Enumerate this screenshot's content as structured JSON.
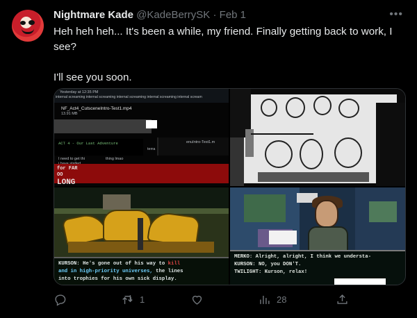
{
  "tweet": {
    "display_name": "Nightmare Kade",
    "handle": "@KadeBerrySK",
    "separator": "·",
    "date": "Feb 1",
    "more_icon": "•••",
    "text_line1": "Heh heh heh... It's been a while, my friend. Finally getting back to work, I see?",
    "text_line2": "I'll see you soon."
  },
  "media": {
    "tile1": {
      "header_small": "Yesterday at 12:35 PM",
      "scream_line": "internal screaming internal screaming internal screaming   internal screaming internal scream",
      "file_name": "NF_Act4_CutsceneIntro-Test1.mp4",
      "file_size": "13.91 MB",
      "act_line": "ACT 4 - Our Last Adventure",
      "fragment_1": "terra",
      "fragment_2": "enuIntro-Test1.m",
      "need_line": "I need to get thi",
      "thing_line": "thing lmao",
      "stalled_line": "i have stalled",
      "far_text": "for FAR",
      "too_text": "OO",
      "long_text": "LONG"
    },
    "tile3": {
      "line1_a": "KURSON: He's gone out of his way to ",
      "line1_b": "kill",
      "line2_a": "and in high-priority universes, ",
      "line2_b": "the lines",
      "line3": "into trophies for his own sick display."
    },
    "tile4": {
      "line1": "MERKO: Alright, alright, I think we understa-",
      "line2": "KURSON: NO, you DON'T.",
      "line3": "TWILIGHT: Kurson, relax!"
    }
  },
  "actions": {
    "reply_icon": "reply-icon",
    "retweet_icon": "retweet-icon",
    "retweet_count": "1",
    "like_icon": "heart-icon",
    "views_icon": "views-icon",
    "views_count": "28",
    "share_icon": "share-icon"
  },
  "colors": {
    "background": "#000000",
    "text": "#e7e9ea",
    "muted": "#71767b",
    "border": "#2f3336"
  }
}
